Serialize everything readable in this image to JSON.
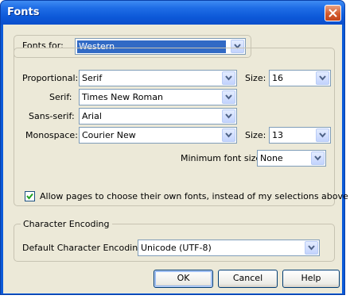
{
  "window": {
    "title": "Fonts"
  },
  "fonts_for": {
    "label": "Fonts for:",
    "value": "Western"
  },
  "fonts": {
    "proportional_label": "Proportional:",
    "proportional_value": "Serif",
    "size_label": "Size:",
    "proportional_size": "16",
    "serif_label": "Serif:",
    "serif_value": "Times New Roman",
    "sans_serif_label": "Sans-serif:",
    "sans_serif_value": "Arial",
    "monospace_label": "Monospace:",
    "monospace_value": "Courier New",
    "monospace_size_label": "Size:",
    "monospace_size": "13",
    "min_size_label": "Minimum font size:",
    "min_size_value": "None"
  },
  "allow_fonts": {
    "label": "Allow pages to choose their own fonts, instead of my selections above",
    "checked": true
  },
  "encoding": {
    "group_label": "Character Encoding",
    "default_label": "Default Character Encoding:",
    "default_value": "Unicode (UTF-8)"
  },
  "buttons": {
    "ok": "OK",
    "cancel": "Cancel",
    "help": "Help"
  },
  "colors": {
    "title_bar": "#0b5ad8",
    "dialog_bg": "#ece9d8",
    "selection": "#316ac5"
  },
  "icons": [
    "close-icon",
    "chevron-down-icon",
    "checkmark-icon"
  ]
}
